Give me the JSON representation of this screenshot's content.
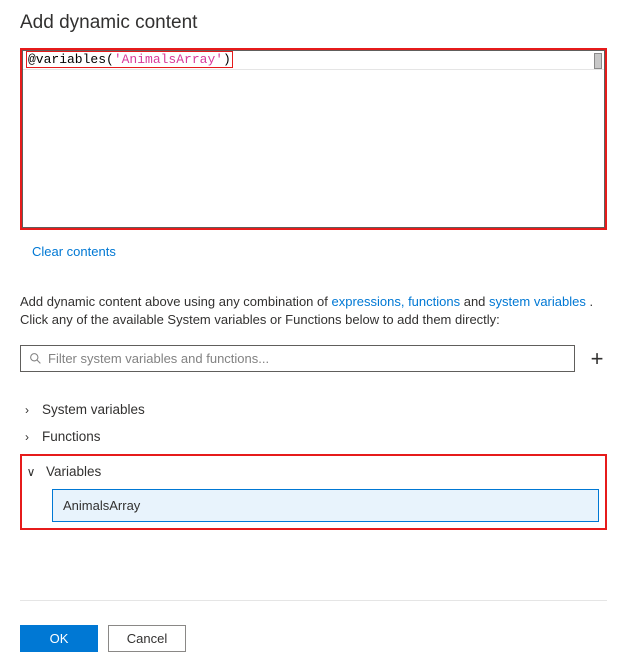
{
  "title": "Add dynamic content",
  "expression": {
    "fn": "@variables",
    "open": "(",
    "arg": "'AnimalsArray'",
    "close": ")"
  },
  "clear_label": "Clear contents",
  "hint": {
    "pre": "Add dynamic content above using any combination of ",
    "link1": "expressions, functions",
    "mid": " and ",
    "link2": "system variables",
    "post1": " .",
    "line2": "Click any of the available System variables or Functions below to add them directly:"
  },
  "filter": {
    "placeholder": "Filter system variables and functions..."
  },
  "plus_label": "+",
  "categories": {
    "system": {
      "label": "System variables"
    },
    "functions": {
      "label": "Functions"
    },
    "variables": {
      "label": "Variables",
      "items": [
        "AnimalsArray"
      ]
    }
  },
  "footer": {
    "ok": "OK",
    "cancel": "Cancel"
  }
}
